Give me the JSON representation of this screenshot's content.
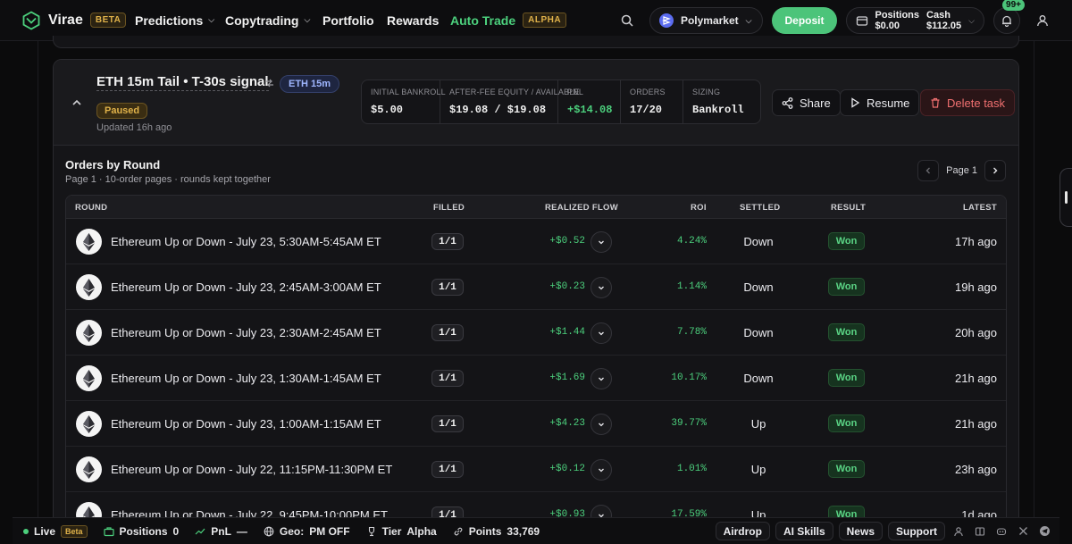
{
  "nav": {
    "brand": "Virae",
    "brand_badge": "BETA",
    "items": [
      {
        "label": "Predictions",
        "dropdown": true
      },
      {
        "label": "Copytrading",
        "dropdown": true
      },
      {
        "label": "Portfolio",
        "dropdown": false
      },
      {
        "label": "Rewards",
        "dropdown": false
      },
      {
        "label": "Auto Trade",
        "dropdown": false,
        "active": true,
        "badge": "ALPHA"
      }
    ],
    "exchange": "Polymarket",
    "deposit": "Deposit",
    "positions_label": "Positions",
    "positions_value": "$0.00",
    "cash_label": "Cash",
    "cash_value": "$112.05",
    "notifications": "99+"
  },
  "task": {
    "title": "ETH 15m Tail • T-30s signal",
    "tag": "ETH 15m",
    "status": "Paused",
    "updated": "Updated 16h ago",
    "stats": [
      {
        "label": "Initial Bankroll",
        "value": "$5.00",
        "positive": false
      },
      {
        "label": "After-fee Equity / Available",
        "value": "$19.08 / $19.08",
        "positive": false
      },
      {
        "label": "PnL",
        "value": "+$14.08",
        "positive": true
      },
      {
        "label": "Orders",
        "value": "17/20",
        "positive": false
      },
      {
        "label": "Sizing",
        "value": "Bankroll",
        "positive": false
      }
    ],
    "actions": {
      "share": "Share",
      "resume": "Resume",
      "delete": "Delete task"
    }
  },
  "orders": {
    "title": "Orders by Round",
    "subtitle": "Page 1 · 10-order pages · rounds kept together",
    "page_label": "Page 1",
    "columns": {
      "round": "ROUND",
      "filled": "FILLED",
      "flow": "REALIZED FLOW",
      "roi": "ROI",
      "settled": "SETTLED",
      "result": "RESULT",
      "latest": "LATEST"
    },
    "rows": [
      {
        "round": "Ethereum Up or Down - July 23, 5:30AM-5:45AM ET",
        "filled": "1/1",
        "flow": "+$0.52",
        "roi": "4.24%",
        "settled": "Down",
        "result": "Won",
        "latest": "17h ago"
      },
      {
        "round": "Ethereum Up or Down - July 23, 2:45AM-3:00AM ET",
        "filled": "1/1",
        "flow": "+$0.23",
        "roi": "1.14%",
        "settled": "Down",
        "result": "Won",
        "latest": "19h ago"
      },
      {
        "round": "Ethereum Up or Down - July 23, 2:30AM-2:45AM ET",
        "filled": "1/1",
        "flow": "+$1.44",
        "roi": "7.78%",
        "settled": "Down",
        "result": "Won",
        "latest": "20h ago"
      },
      {
        "round": "Ethereum Up or Down - July 23, 1:30AM-1:45AM ET",
        "filled": "1/1",
        "flow": "+$1.69",
        "roi": "10.17%",
        "settled": "Down",
        "result": "Won",
        "latest": "21h ago"
      },
      {
        "round": "Ethereum Up or Down - July 23, 1:00AM-1:15AM ET",
        "filled": "1/1",
        "flow": "+$4.23",
        "roi": "39.77%",
        "settled": "Up",
        "result": "Won",
        "latest": "21h ago"
      },
      {
        "round": "Ethereum Up or Down - July 22, 11:15PM-11:30PM ET",
        "filled": "1/1",
        "flow": "+$0.12",
        "roi": "1.01%",
        "settled": "Up",
        "result": "Won",
        "latest": "23h ago"
      },
      {
        "round": "Ethereum Up or Down - July 22, 9:45PM-10:00PM ET",
        "filled": "1/1",
        "flow": "+$0.93",
        "roi": "17.59%",
        "settled": "Up",
        "result": "Won",
        "latest": "1d ago"
      }
    ]
  },
  "statusbar": {
    "live": "Live",
    "beta": "Beta",
    "positions_label": "Positions",
    "positions_value": "0",
    "pnl_label": "PnL",
    "pnl_value": "—",
    "geo_label": "Geo:",
    "geo_value": "PM OFF",
    "tier_label": "Tier",
    "tier_value": "Alpha",
    "points_label": "Points",
    "points_value": "33,769",
    "links": [
      "Airdrop",
      "AI Skills",
      "News",
      "Support"
    ]
  },
  "colors": {
    "accent": "#4cd07d",
    "deposit": "#4cc47a",
    "badge": "#e0b24a",
    "danger": "#f07070"
  }
}
